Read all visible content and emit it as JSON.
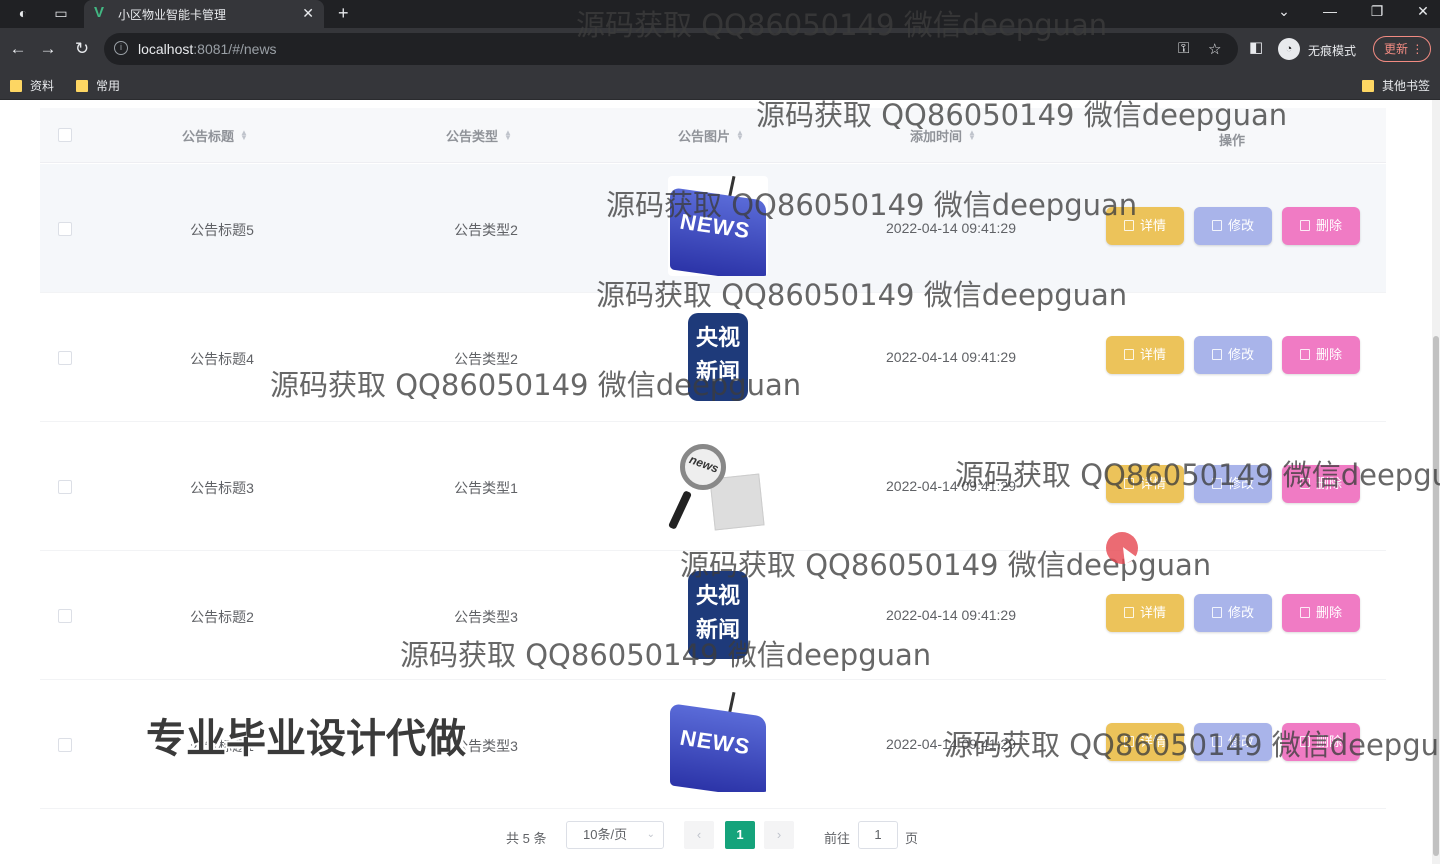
{
  "browser": {
    "tab_title": "小区物业智能卡管理",
    "url_host": "localhost",
    "url_rest": ":8081/#/news",
    "profile_label": "无痕模式",
    "update_label": "更新",
    "bookmarks": [
      "资料",
      "常用"
    ],
    "other_bookmarks": "其他书签"
  },
  "table": {
    "headers": {
      "title": "公告标题",
      "type": "公告类型",
      "image": "公告图片",
      "time": "添加时间",
      "actions": "操作"
    },
    "rows": [
      {
        "title": "公告标题5",
        "type": "公告类型2",
        "image": "news-key",
        "time": "2022-04-14 09:41:29"
      },
      {
        "title": "公告标题4",
        "type": "公告类型2",
        "image": "cctv-news",
        "time": "2022-04-14 09:41:29"
      },
      {
        "title": "公告标题3",
        "type": "公告类型1",
        "image": "magnifier-news",
        "time": "2022-04-14 09:41:29"
      },
      {
        "title": "公告标题2",
        "type": "公告类型3",
        "image": "cctv-news",
        "time": "2022-04-14 09:41:29"
      },
      {
        "title": "公告标题1",
        "type": "公告类型3",
        "image": "news-key",
        "time": "2022-04-14 09:41:29"
      }
    ],
    "actions": {
      "detail": "详情",
      "edit": "修改",
      "delete": "删除"
    },
    "cctv_text_top": "央视",
    "cctv_text_bottom": "新闻",
    "news_key_text": "NEWS",
    "news_lens_text": "news"
  },
  "pagination": {
    "total": "共 5 条",
    "page_size": "10条/页",
    "current": "1",
    "goto": "前往",
    "goto_value": "1",
    "page_suffix": "页"
  },
  "overlays": {
    "watermark": "源码获取 QQ86050149 微信deepguan",
    "promo": "专业毕业设计代做"
  },
  "colors": {
    "detail": "#ecc35a",
    "edit": "#a9b4ea",
    "delete": "#f07bc4",
    "pager_active": "#15a37b"
  }
}
